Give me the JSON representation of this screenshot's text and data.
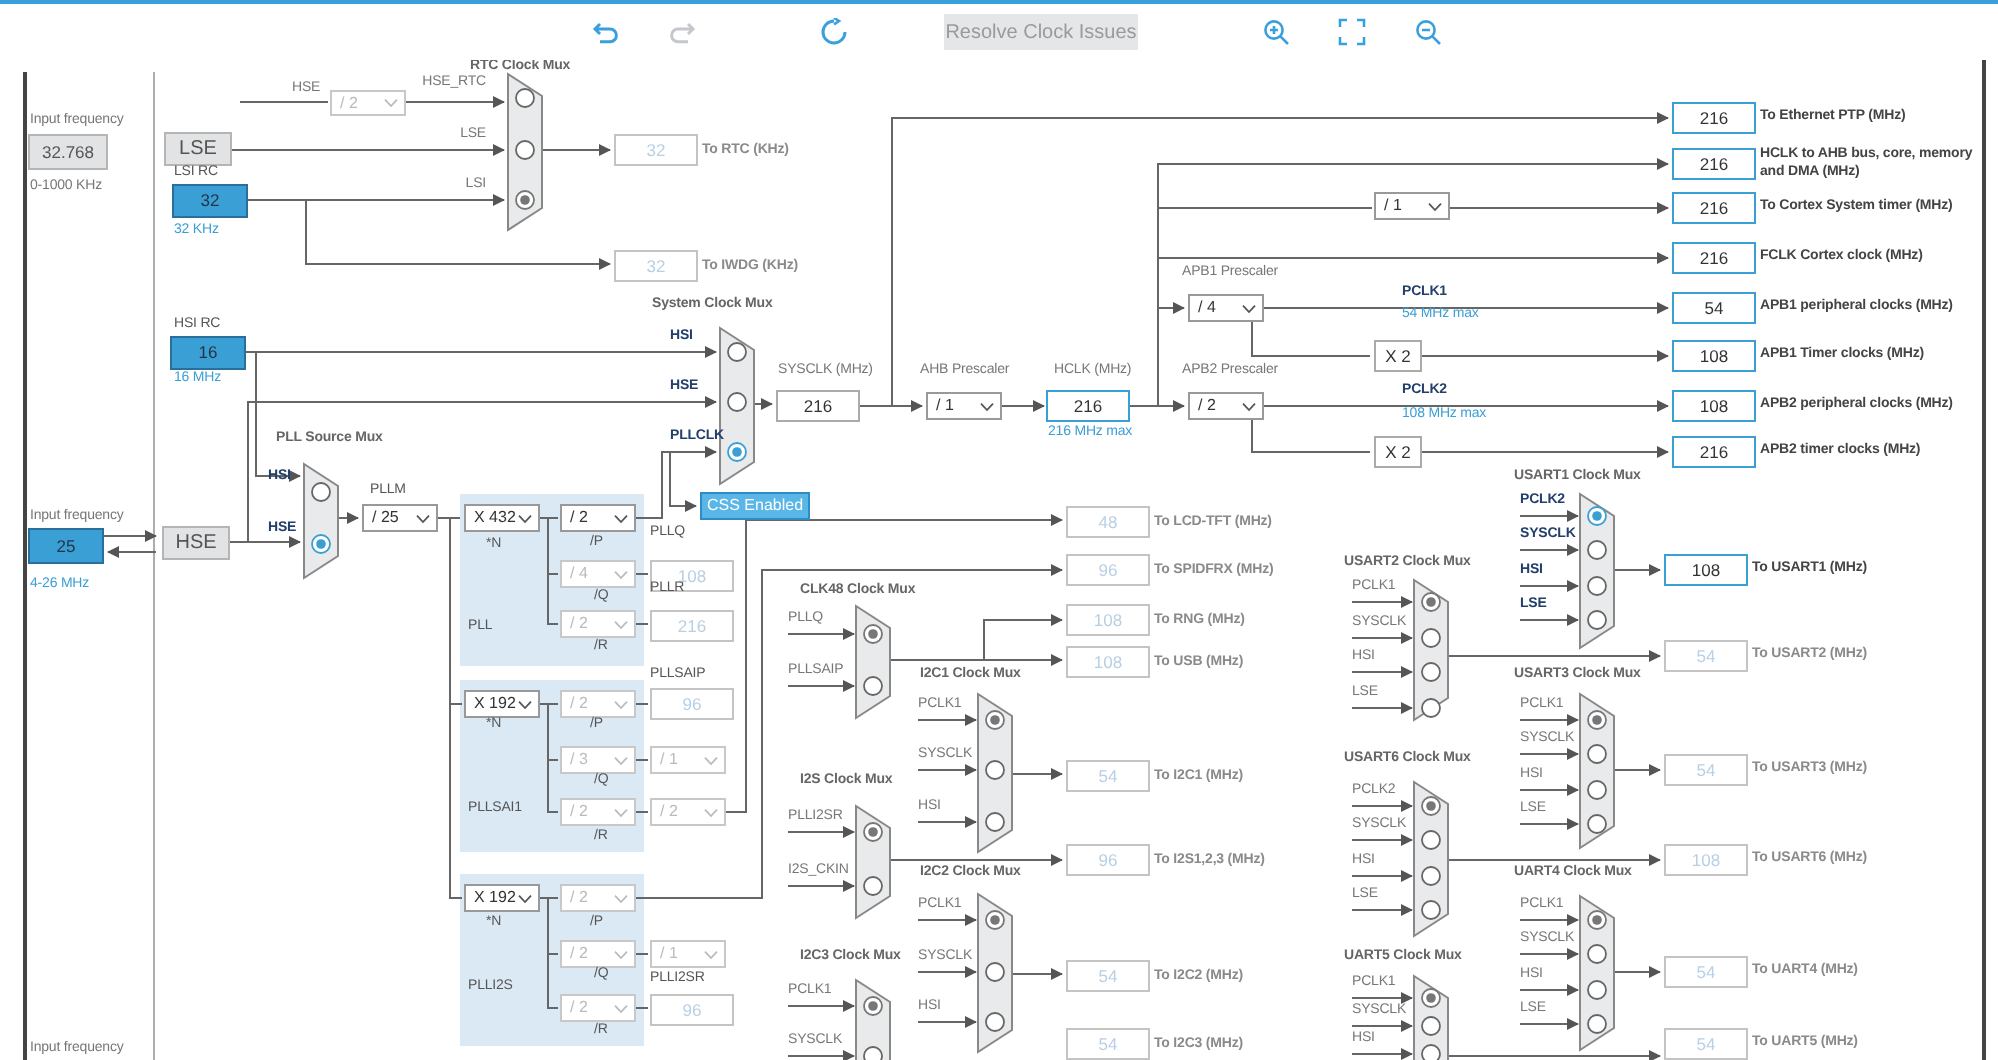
{
  "toolbar": {
    "tools": [
      {
        "kind": "undo",
        "disabled": false
      },
      {
        "kind": "redo",
        "disabled": true
      },
      {
        "kind": "refresh",
        "disabled": false
      },
      {
        "kind": "button",
        "label": "Resolve Clock Issues",
        "disabled": true
      },
      {
        "kind": "zoom_in",
        "disabled": false
      },
      {
        "kind": "fit",
        "disabled": false
      },
      {
        "kind": "zoom_out",
        "disabled": false
      }
    ]
  },
  "sources": [
    {
      "caption": "Input frequency",
      "value": "32.768",
      "range": "0-1000 KHz",
      "enabled": false,
      "block": "LSE"
    },
    {
      "caption": "Input frequency",
      "value": "25",
      "range": "4-26 MHz",
      "enabled": true,
      "block": "HSE"
    }
  ],
  "rc_oscillators": [
    {
      "title": "LSI RC",
      "value": "32",
      "unit": "32 KHz"
    },
    {
      "title": "HSI RC",
      "value": "16",
      "unit": "16 MHz"
    }
  ],
  "css_button": {
    "label": "CSS Enabled",
    "on": true
  },
  "muxes": [
    {
      "title": "RTC Clock Mux",
      "active": false,
      "inputs": [
        {
          "label": "HSE_RTC",
          "selected": false
        },
        {
          "label": "LSE",
          "selected": false
        },
        {
          "label": "LSI",
          "selected": true
        }
      ]
    },
    {
      "title": "System Clock Mux",
      "active": true,
      "inputs": [
        {
          "label": "HSI",
          "selected": false
        },
        {
          "label": "HSE",
          "selected": false
        },
        {
          "label": "PLLCLK",
          "selected": true
        }
      ]
    },
    {
      "title": "PLL Source Mux",
      "active": true,
      "inputs": [
        {
          "label": "HSI",
          "selected": false
        },
        {
          "label": "HSE",
          "selected": true
        }
      ]
    },
    {
      "title": "CLK48 Clock Mux",
      "active": false,
      "inputs": [
        {
          "label": "PLLQ",
          "selected": true
        },
        {
          "label": "PLLSAIP",
          "selected": false
        }
      ]
    },
    {
      "title": "I2C1 Clock Mux",
      "active": false,
      "inputs": [
        {
          "label": "PCLK1",
          "selected": true
        },
        {
          "label": "SYSCLK",
          "selected": false
        },
        {
          "label": "HSI",
          "selected": false
        }
      ]
    },
    {
      "title": "I2S Clock Mux",
      "active": false,
      "inputs": [
        {
          "label": "PLLI2SR",
          "selected": true
        },
        {
          "label": "I2S_CKIN",
          "selected": false
        }
      ]
    },
    {
      "title": "I2C2 Clock Mux",
      "active": false,
      "inputs": [
        {
          "label": "PCLK1",
          "selected": true
        },
        {
          "label": "SYSCLK",
          "selected": false
        },
        {
          "label": "HSI",
          "selected": false
        }
      ]
    },
    {
      "title": "I2C3 Clock Mux",
      "active": false,
      "inputs": [
        {
          "label": "PCLK1",
          "selected": true
        },
        {
          "label": "SYSCLK",
          "selected": false
        }
      ]
    },
    {
      "title": "USART1 Clock Mux",
      "active": true,
      "inputs": [
        {
          "label": "PCLK2",
          "selected": true
        },
        {
          "label": "SYSCLK",
          "selected": false
        },
        {
          "label": "HSI",
          "selected": false
        },
        {
          "label": "LSE",
          "selected": false
        }
      ]
    },
    {
      "title": "USART2 Clock Mux",
      "active": false,
      "inputs": [
        {
          "label": "PCLK1",
          "selected": true
        },
        {
          "label": "SYSCLK",
          "selected": false
        },
        {
          "label": "HSI",
          "selected": false
        },
        {
          "label": "LSE",
          "selected": false
        }
      ]
    },
    {
      "title": "USART3 Clock Mux",
      "active": false,
      "inputs": [
        {
          "label": "PCLK1",
          "selected": true
        },
        {
          "label": "SYSCLK",
          "selected": false
        },
        {
          "label": "HSI",
          "selected": false
        },
        {
          "label": "LSE",
          "selected": false
        }
      ]
    },
    {
      "title": "USART6 Clock Mux",
      "active": false,
      "inputs": [
        {
          "label": "PCLK2",
          "selected": true
        },
        {
          "label": "SYSCLK",
          "selected": false
        },
        {
          "label": "HSI",
          "selected": false
        },
        {
          "label": "LSE",
          "selected": false
        }
      ]
    },
    {
      "title": "UART4 Clock Mux",
      "active": false,
      "inputs": [
        {
          "label": "PCLK1",
          "selected": true
        },
        {
          "label": "SYSCLK",
          "selected": false
        },
        {
          "label": "HSI",
          "selected": false
        },
        {
          "label": "LSE",
          "selected": false
        }
      ]
    },
    {
      "title": "UART5 Clock Mux",
      "active": false,
      "inputs": [
        {
          "label": "PCLK1",
          "selected": true
        },
        {
          "label": "SYSCLK",
          "selected": false
        },
        {
          "label": "HSI",
          "selected": false
        }
      ]
    }
  ],
  "pll_panels": [
    {
      "title": "PLL"
    },
    {
      "title": "PLLSAI1"
    },
    {
      "title": "PLLI2S"
    }
  ],
  "dropdowns": [
    {
      "value": "/ 2",
      "enabled": false
    },
    {
      "value": "/ 25",
      "enabled": true
    },
    {
      "value": "X 432",
      "enabled": true
    },
    {
      "value": "/ 2",
      "enabled": true
    },
    {
      "value": "/ 4",
      "enabled": false
    },
    {
      "value": "/ 2",
      "enabled": false
    },
    {
      "value": "X 192",
      "enabled": true
    },
    {
      "value": "/ 2",
      "enabled": false
    },
    {
      "value": "/ 3",
      "enabled": false
    },
    {
      "value": "/ 1",
      "enabled": false
    },
    {
      "value": "/ 2",
      "enabled": false
    },
    {
      "value": "/ 2",
      "enabled": false
    },
    {
      "value": "X 192",
      "enabled": true
    },
    {
      "value": "/ 2",
      "enabled": false
    },
    {
      "value": "/ 2",
      "enabled": false
    },
    {
      "value": "/ 1",
      "enabled": false
    },
    {
      "value": "/ 2",
      "enabled": false
    },
    {
      "value": "/ 1",
      "enabled": true
    },
    {
      "value": "/ 1",
      "enabled": true
    },
    {
      "value": "/ 4",
      "enabled": true
    },
    {
      "value": "/ 2",
      "enabled": true
    }
  ],
  "values": [
    {
      "value": "108",
      "active": false,
      "disabled": true
    },
    {
      "value": "216",
      "active": false,
      "disabled": true
    },
    {
      "value": "96",
      "active": false,
      "disabled": true
    },
    {
      "value": "96",
      "active": false,
      "disabled": true
    },
    {
      "value": "216",
      "active": false,
      "disabled": false
    },
    {
      "value": "216",
      "active": true,
      "disabled": false
    },
    {
      "value": "X 2",
      "active": false,
      "disabled": false
    },
    {
      "value": "X 2",
      "active": false,
      "disabled": false
    }
  ],
  "outputs": [
    {
      "value": "32",
      "label": "To RTC (KHz)",
      "active": false
    },
    {
      "value": "32",
      "label": "To IWDG (KHz)",
      "active": false
    },
    {
      "value": "216",
      "label": "To Ethernet PTP (MHz)",
      "active": true
    },
    {
      "value": "216",
      "label": "HCLK to AHB bus, core, memory and DMA (MHz)",
      "active": true
    },
    {
      "value": "216",
      "label": "To Cortex System timer (MHz)",
      "active": true
    },
    {
      "value": "216",
      "label": "FCLK Cortex clock (MHz)",
      "active": true
    },
    {
      "value": "54",
      "label": "APB1 peripheral clocks (MHz)",
      "active": true
    },
    {
      "value": "108",
      "label": "APB1 Timer clocks (MHz)",
      "active": true
    },
    {
      "value": "108",
      "label": "APB2 peripheral clocks (MHz)",
      "active": true
    },
    {
      "value": "216",
      "label": "APB2 timer clocks (MHz)",
      "active": true
    },
    {
      "value": "48",
      "label": "To LCD-TFT (MHz)",
      "active": false
    },
    {
      "value": "96",
      "label": "To SPIDFRX (MHz)",
      "active": false
    },
    {
      "value": "108",
      "label": "To RNG (MHz)",
      "active": false
    },
    {
      "value": "108",
      "label": "To USB (MHz)",
      "active": false
    },
    {
      "value": "54",
      "label": "To I2C1 (MHz)",
      "active": false
    },
    {
      "value": "96",
      "label": "To I2S1,2,3 (MHz)",
      "active": false
    },
    {
      "value": "54",
      "label": "To I2C2 (MHz)",
      "active": false
    },
    {
      "value": "54",
      "label": "To I2C3 (MHz)",
      "active": false
    },
    {
      "value": "108",
      "label": "To USART1 (MHz)",
      "active": true
    },
    {
      "value": "54",
      "label": "To USART2 (MHz)",
      "active": false
    },
    {
      "value": "54",
      "label": "To USART3 (MHz)",
      "active": false
    },
    {
      "value": "108",
      "label": "To USART6 (MHz)",
      "active": false
    },
    {
      "value": "54",
      "label": "To UART4 (MHz)",
      "active": false
    },
    {
      "value": "54",
      "label": "To UART5 (MHz)",
      "active": false
    }
  ],
  "labels": [
    {
      "text": "HSE",
      "kind": "signal"
    },
    {
      "text": "PLLM",
      "kind": "pll"
    },
    {
      "text": "*N",
      "kind": "pll"
    },
    {
      "text": "/P",
      "kind": "pll"
    },
    {
      "text": "PLLQ",
      "kind": "pll"
    },
    {
      "text": "/Q",
      "kind": "pll"
    },
    {
      "text": "PLLR",
      "kind": "pll"
    },
    {
      "text": "/R",
      "kind": "pll"
    },
    {
      "text": "PLLSAIP",
      "kind": "pll"
    },
    {
      "text": "*N",
      "kind": "pll"
    },
    {
      "text": "/P",
      "kind": "pll"
    },
    {
      "text": "/Q",
      "kind": "pll"
    },
    {
      "text": "/R",
      "kind": "pll"
    },
    {
      "text": "*N",
      "kind": "pll"
    },
    {
      "text": "/P",
      "kind": "pll"
    },
    {
      "text": "/Q",
      "kind": "pll"
    },
    {
      "text": "PLLI2SR",
      "kind": "pll"
    },
    {
      "text": "/R",
      "kind": "pll"
    },
    {
      "text": "SYSCLK (MHz)",
      "kind": "signal"
    },
    {
      "text": "AHB Prescaler",
      "kind": "signal"
    },
    {
      "text": "HCLK (MHz)",
      "kind": "signal"
    },
    {
      "text": "216 MHz max",
      "kind": "hint"
    },
    {
      "text": "APB1 Prescaler",
      "kind": "signal"
    },
    {
      "text": "PCLK1",
      "kind": "clock"
    },
    {
      "text": "54 MHz max",
      "kind": "hint"
    },
    {
      "text": "APB2 Prescaler",
      "kind": "signal"
    },
    {
      "text": "PCLK2",
      "kind": "clock"
    },
    {
      "text": "108 MHz max",
      "kind": "hint"
    },
    {
      "text": "Input frequency",
      "kind": "signal"
    }
  ]
}
